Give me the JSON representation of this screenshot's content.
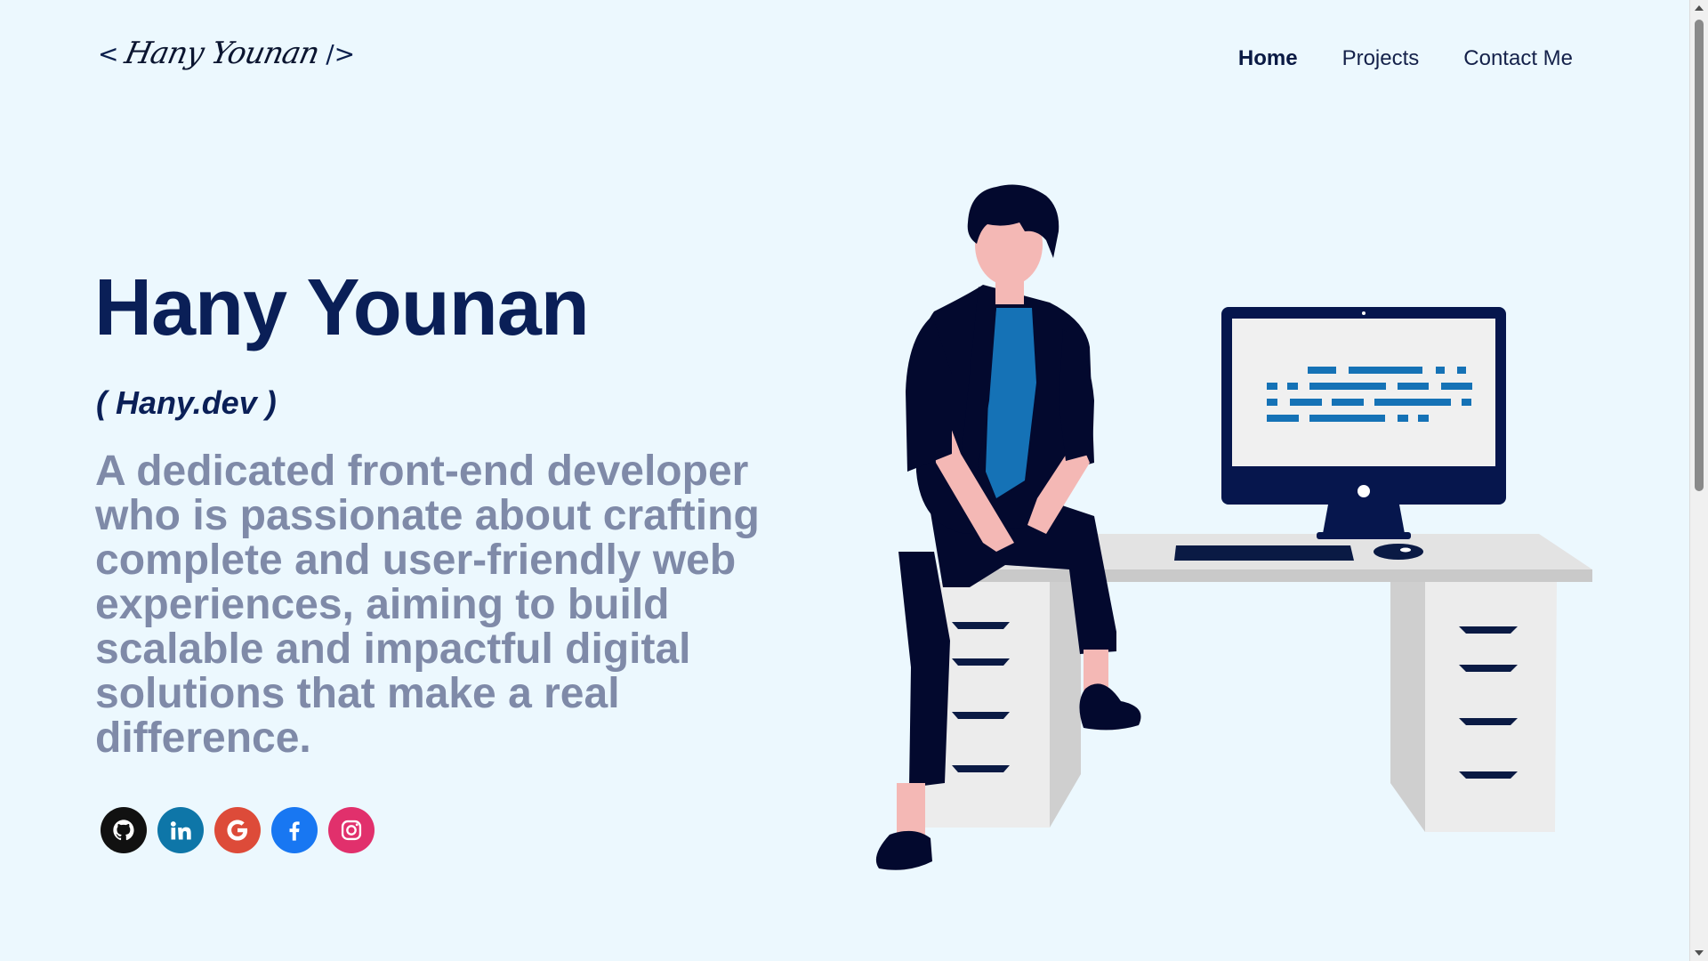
{
  "header": {
    "logo": {
      "open_bracket": "<",
      "signature": "Hany Younan",
      "close_bracket": "/>"
    },
    "nav": [
      {
        "label": "Home",
        "active": true
      },
      {
        "label": "Projects",
        "active": false
      },
      {
        "label": "Contact Me",
        "active": false
      }
    ]
  },
  "hero": {
    "name": "Hany Younan",
    "handle": "( Hany.dev )",
    "description": "A dedicated front-end developer who is passionate about crafting complete and user-friendly web experiences, aiming to build scalable and impactful digital solutions that make a real difference."
  },
  "social": [
    {
      "icon": "github-icon",
      "color": "#111111"
    },
    {
      "icon": "linkedin-icon",
      "color": "#0e76a8"
    },
    {
      "icon": "google-icon",
      "color": "#dd4b39"
    },
    {
      "icon": "facebook-icon",
      "color": "#1877f2"
    },
    {
      "icon": "instagram-icon",
      "color": "#e1306c"
    }
  ],
  "colors": {
    "background": "#ecf8fe",
    "primary_text": "#0a1f57",
    "muted_text": "#7f8aa8",
    "illustration_navy": "#03092e",
    "illustration_blue": "#1572b6"
  }
}
